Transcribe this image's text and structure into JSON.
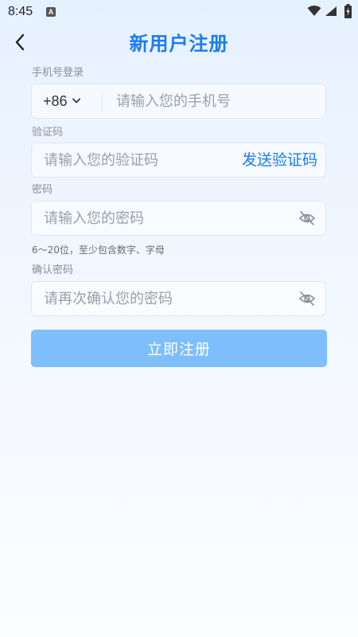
{
  "status_bar": {
    "time": "8:45",
    "notification_icon": "A"
  },
  "header": {
    "title": "新用户注册",
    "back_icon": "chevron-left-icon"
  },
  "phone": {
    "label": "手机号登录",
    "country_code": "+86",
    "placeholder": "请输入您的手机号"
  },
  "code": {
    "label": "验证码",
    "placeholder": "请输入您的验证码",
    "send_label": "发送验证码"
  },
  "password": {
    "label": "密码",
    "placeholder": "请输入您的密码",
    "hint": "6～20位，至少包含数字、字母"
  },
  "confirm": {
    "label": "确认密码",
    "placeholder": "请再次确认您的密码"
  },
  "submit": {
    "label": "立即注册"
  },
  "colors": {
    "accent": "#1a7cf5",
    "button": "#7ebefc"
  }
}
